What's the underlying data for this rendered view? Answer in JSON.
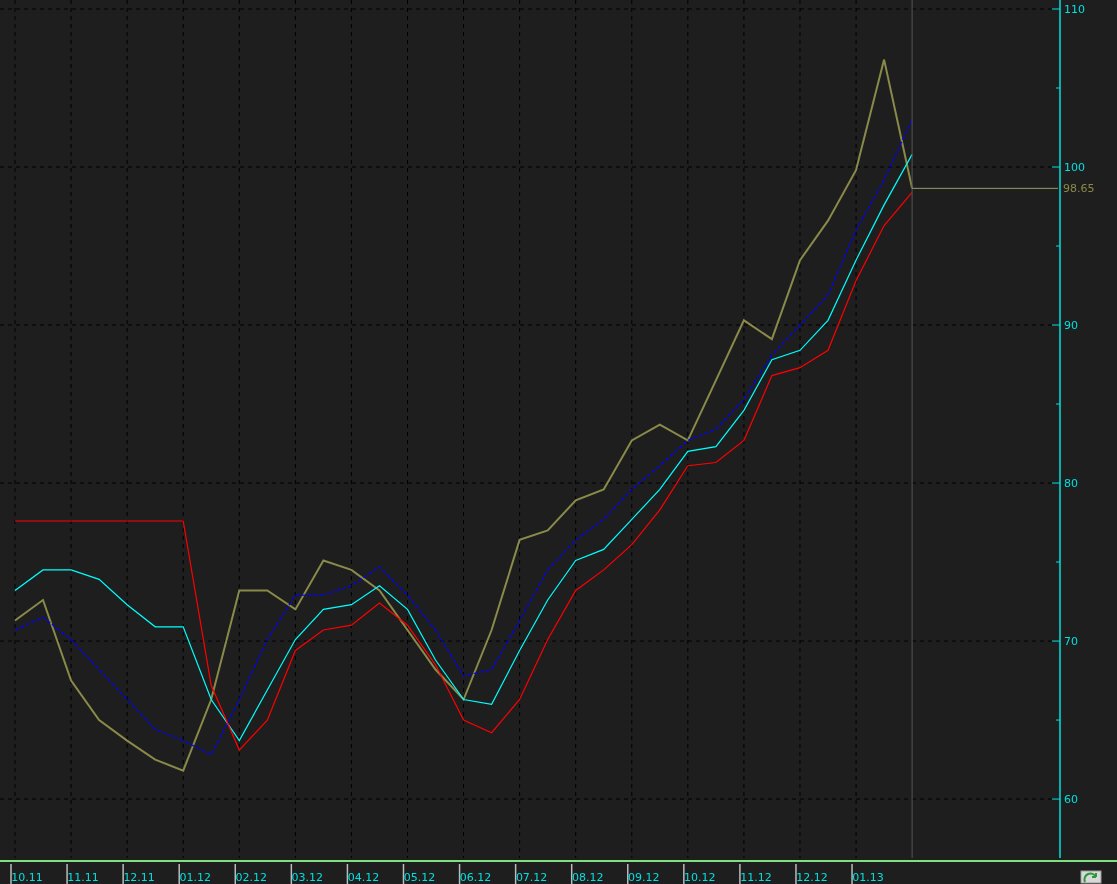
{
  "chart_data": {
    "type": "line",
    "categories": [
      "10.11",
      null,
      "11.11",
      null,
      "12.11",
      null,
      "01.12",
      null,
      "02.12",
      null,
      "03.12",
      null,
      "04.12",
      null,
      "05.12",
      null,
      "06.12",
      null,
      "07.12",
      null,
      "08.12",
      null,
      "09.12",
      null,
      "10.12",
      null,
      "11.12",
      null,
      "12.12",
      null,
      "01.13",
      null,
      null
    ],
    "ylim": [
      56.27,
      110.57
    ],
    "grid": true,
    "yticks": [
      60,
      70,
      80,
      90,
      100,
      110
    ],
    "series": [
      {
        "color": "#8a8a4a",
        "values": [
          71.3,
          72.6,
          67.5,
          65.0,
          63.7,
          62.5,
          61.8,
          66.3,
          73.2,
          73.2,
          72.0,
          75.1,
          74.5,
          73.2,
          70.7,
          68.2,
          66.3,
          70.7,
          76.4,
          77.0,
          78.9,
          79.6,
          82.7,
          83.7,
          82.7,
          86.5,
          90.3,
          89.1,
          94.1,
          96.6,
          99.8,
          106.8,
          98.65
        ]
      },
      {
        "color": "#0000ff",
        "line_style": "dashed",
        "values": [
          70.7,
          71.5,
          70.1,
          68.2,
          66.3,
          64.4,
          63.7,
          62.8,
          66.3,
          70.1,
          72.9,
          72.9,
          73.5,
          74.7,
          72.9,
          70.7,
          67.8,
          68.2,
          71.3,
          74.5,
          76.4,
          77.7,
          79.6,
          81.1,
          82.7,
          83.4,
          85.3,
          88.1,
          90.0,
          91.9,
          96.0,
          99.2,
          103.0
        ]
      },
      {
        "color": "#00ffff",
        "values": [
          73.2,
          74.5,
          74.5,
          73.9,
          72.3,
          70.9,
          70.9,
          66.3,
          63.7,
          66.9,
          70.1,
          72.0,
          72.3,
          73.5,
          72.0,
          68.8,
          66.3,
          66.0,
          69.4,
          72.6,
          75.1,
          75.8,
          77.7,
          79.6,
          82.0,
          82.3,
          84.6,
          87.8,
          88.4,
          90.3,
          94.1,
          97.6,
          100.8
        ]
      },
      {
        "color": "#ff0000",
        "values": [
          77.6,
          77.6,
          77.6,
          77.6,
          77.6,
          77.6,
          77.6,
          67.2,
          63.1,
          65.0,
          69.4,
          70.7,
          71.0,
          72.4,
          71.0,
          68.5,
          65.0,
          64.2,
          66.3,
          70.1,
          73.2,
          74.5,
          76.1,
          78.3,
          81.1,
          81.3,
          82.7,
          86.8,
          87.3,
          88.4,
          92.8,
          96.3,
          98.4
        ]
      }
    ],
    "annotations": [
      "98.65"
    ]
  }
}
